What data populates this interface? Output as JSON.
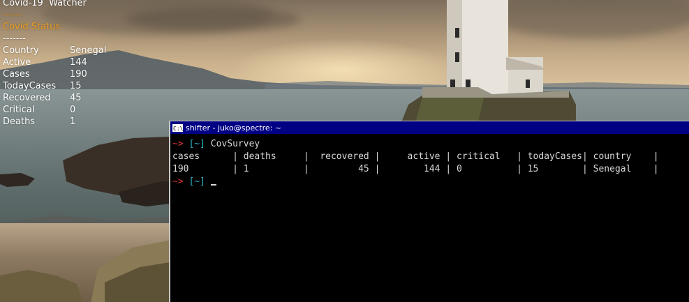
{
  "conky": {
    "title": "Covid-19  Watcher",
    "separator_top": "------",
    "section": "Covid  Status",
    "separator_section": "-------",
    "rows": [
      {
        "label": "Country",
        "value": "Senegal"
      },
      {
        "label": "Active",
        "value": "144"
      },
      {
        "label": "Cases",
        "value": "190"
      },
      {
        "label": "TodayCases",
        "value": "15"
      },
      {
        "label": "Recovered",
        "value": "45"
      },
      {
        "label": "Critical",
        "value": "0"
      },
      {
        "label": "Deaths",
        "value": "1"
      }
    ]
  },
  "terminal": {
    "icon_text": "C:\\",
    "title": "shifter - juko@spectre: ~",
    "prompt_arrow": "~>",
    "prompt_dir": "[~]",
    "command": "CovSurvey",
    "table_header": "cases      | deaths     |  recovered |     active | critical   | todayCases| country    |",
    "table_row": "190        | 1          |         45 |        144 | 0          | 15        | Senegal    |"
  },
  "colors": {
    "conky_accent": "#f0a020",
    "titlebar": "#000084",
    "prompt_arrow": "#e03838",
    "prompt_dir": "#2fb5c8"
  }
}
